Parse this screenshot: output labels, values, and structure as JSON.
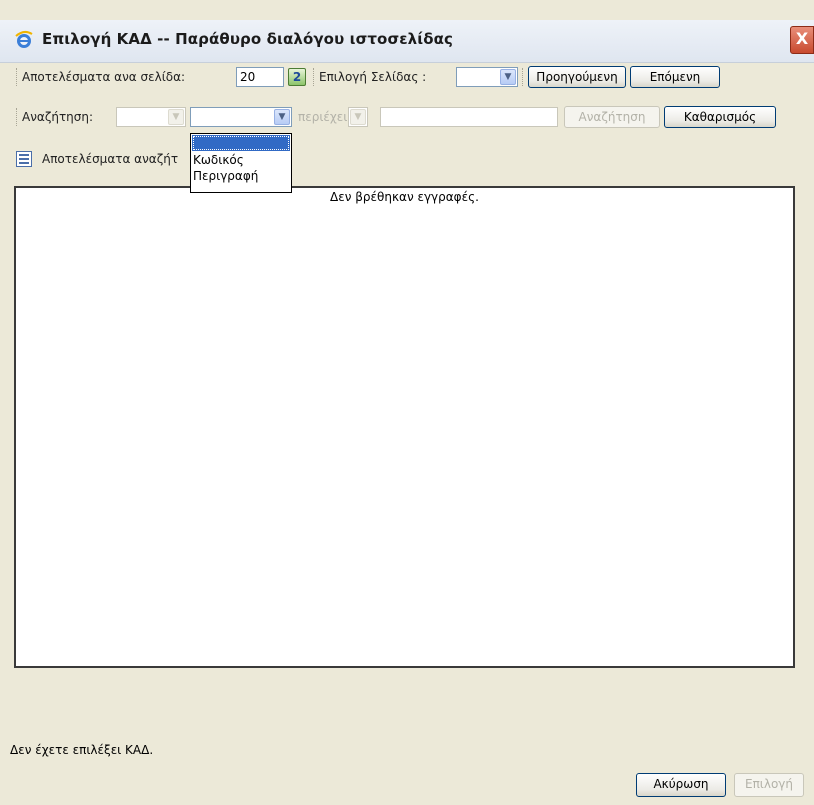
{
  "window": {
    "title": "Επιλογή ΚΑΔ -- Παράθυρο διαλόγου ιστοσελίδας",
    "close_label": "X"
  },
  "toolbar": {
    "results_per_page_label": "Αποτελέσματα ανα σελίδα:",
    "results_per_page_value": "20",
    "refresh_label": "2",
    "page_select_label": "Επιλογή Σελίδας :",
    "page_select_value": "",
    "prev_button": "Προηγούμενη",
    "next_button": "Επόμενη"
  },
  "search": {
    "label": "Αναζήτηση:",
    "field_select_value": "",
    "operator_label": "περιέχει",
    "search_value": "",
    "search_button": "Αναζήτηση",
    "clear_button": "Καθαρισμός"
  },
  "dropdown": {
    "options": [
      "",
      "Κωδικός",
      "Περιγραφή"
    ]
  },
  "results": {
    "header_label": "Αποτελέσματα αναζήτ",
    "empty_message": "Δεν βρέθηκαν εγγραφές."
  },
  "status": {
    "message": "Δεν έχετε επιλέξει ΚΑΔ."
  },
  "footer": {
    "cancel_button": "Ακύρωση",
    "select_button": "Επιλογή"
  }
}
